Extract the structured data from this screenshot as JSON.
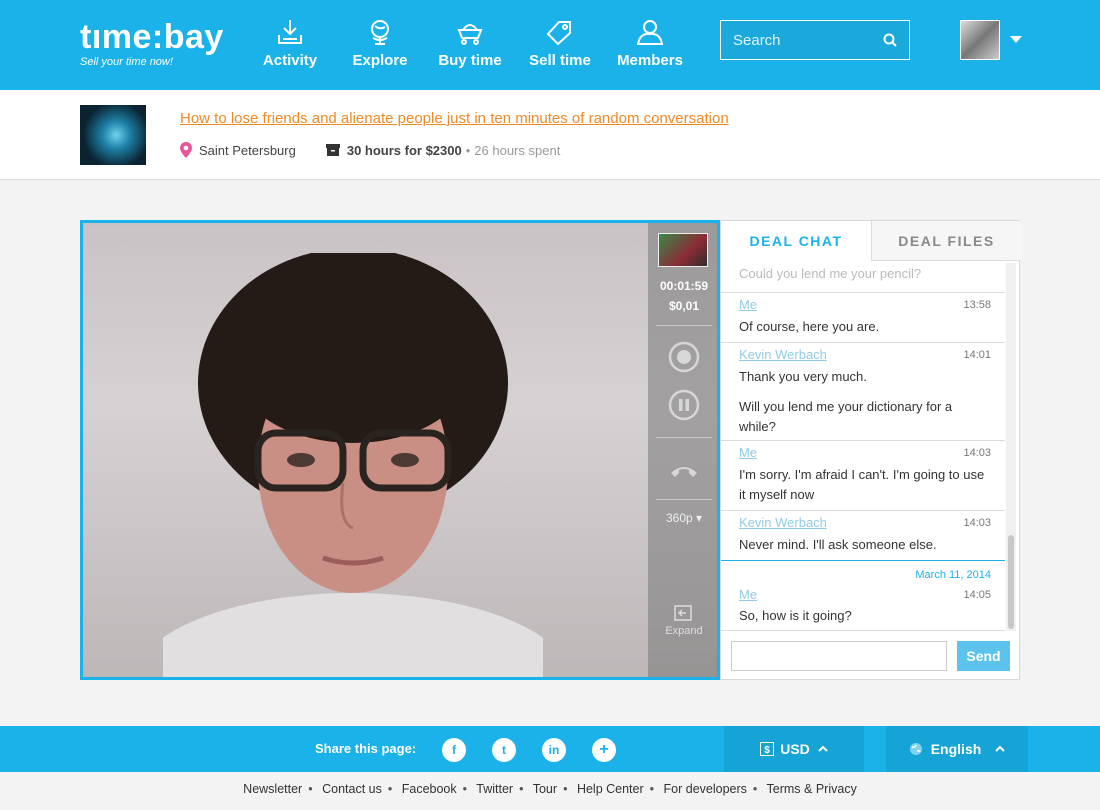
{
  "header": {
    "logo": "tıme:bay",
    "tagline": "Sell your time now!",
    "nav": [
      {
        "label": "Activity",
        "icon": "download-tray-icon"
      },
      {
        "label": "Explore",
        "icon": "globe-icon"
      },
      {
        "label": "Buy time",
        "icon": "shopping-cart-icon"
      },
      {
        "label": "Sell time",
        "icon": "price-tag-icon"
      },
      {
        "label": "Members",
        "icon": "user-icon"
      }
    ],
    "search_placeholder": "Search"
  },
  "deal": {
    "title": "How to lose friends and alienate people just in ten minutes of random conversation",
    "location": "Saint Petersburg",
    "hours_price": "30 hours for $2300",
    "separator": "•",
    "spent": "26 hours spent"
  },
  "video": {
    "timer": "00:01:59",
    "cost": "$0,01",
    "quality": "360p ▾",
    "expand": "Expand"
  },
  "chat": {
    "tabs": [
      "DEAL CHAT",
      "DEAL FILES"
    ],
    "faded_message": "Could you lend me your pencil?",
    "messages": [
      {
        "author": "Me",
        "time": "13:58",
        "text": "Of course, here you are."
      },
      {
        "author": "Kevin Werbach",
        "time": "14:01",
        "text": "Thank you very much."
      },
      {
        "author": "",
        "time": "",
        "text": "Will you lend me your dictionary for a while?"
      },
      {
        "author": "Me",
        "time": "14:03",
        "text": "I'm sorry. I'm afraid I can't. I'm going to use it myself now"
      },
      {
        "author": "Kevin Werbach",
        "time": "14:03",
        "text": "Never mind. I'll ask someone else."
      },
      {
        "date": "March 11, 2014",
        "author": "Me",
        "time": "14:05",
        "text": "So, how is it going?"
      }
    ],
    "send_label": "Send",
    "input_value": ""
  },
  "footer": {
    "share_label": "Share this page:",
    "social": [
      "f",
      "t",
      "in",
      "+"
    ],
    "currency": "USD",
    "language": "English",
    "links": [
      "Newsletter",
      "Contact us",
      "Facebook",
      "Twitter",
      "Tour",
      "Help Center",
      "For developers",
      "Terms & Privacy"
    ]
  },
  "colors": {
    "brand": "#1ab2e8",
    "link": "#f08a24"
  }
}
